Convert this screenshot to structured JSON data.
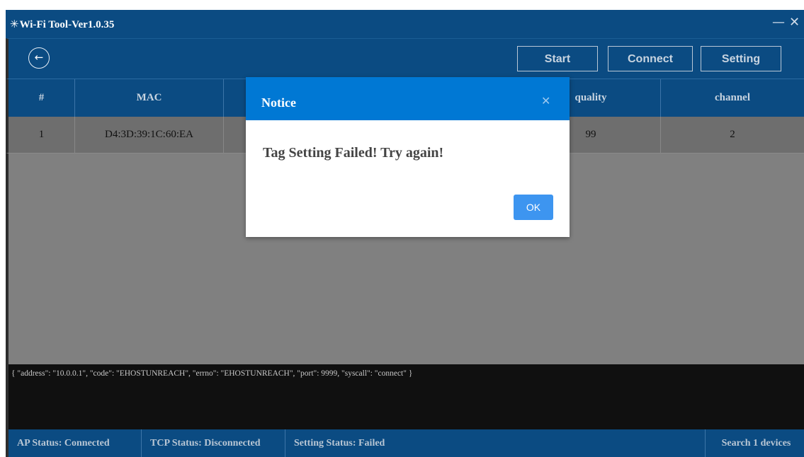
{
  "window": {
    "title_icon": "✳",
    "title": "Wi-Fi Tool-Ver1.0.35",
    "minimize_glyph": "—",
    "close_glyph": "✕"
  },
  "toolbar": {
    "back_glyph": "←",
    "start_label": "Start",
    "connect_label": "Connect",
    "setting_label": "Setting"
  },
  "table": {
    "columns": [
      "#",
      "MAC",
      "",
      "",
      "quality",
      "channel"
    ],
    "rows": [
      [
        "1",
        "D4:3D:39:1C:60:EA",
        "",
        "",
        "99",
        "2"
      ]
    ]
  },
  "log": {
    "text": "{ \"address\": \"10.0.0.1\", \"code\": \"EHOSTUNREACH\", \"errno\": \"EHOSTUNREACH\", \"port\": 9999, \"syscall\": \"connect\" }"
  },
  "status": {
    "ap": "AP Status: Connected",
    "tcp": "TCP Status: Disconnected",
    "setting": "Setting Status: Failed",
    "search": "Search 1 devices"
  },
  "dialog": {
    "title": "Notice",
    "close_glyph": "✕",
    "message": "Tag Setting Failed! Try again!",
    "ok_label": "OK"
  },
  "colors": {
    "primary": "#0b4b82",
    "dialog_header": "#0078d4",
    "ok_button": "#3d95f0"
  }
}
